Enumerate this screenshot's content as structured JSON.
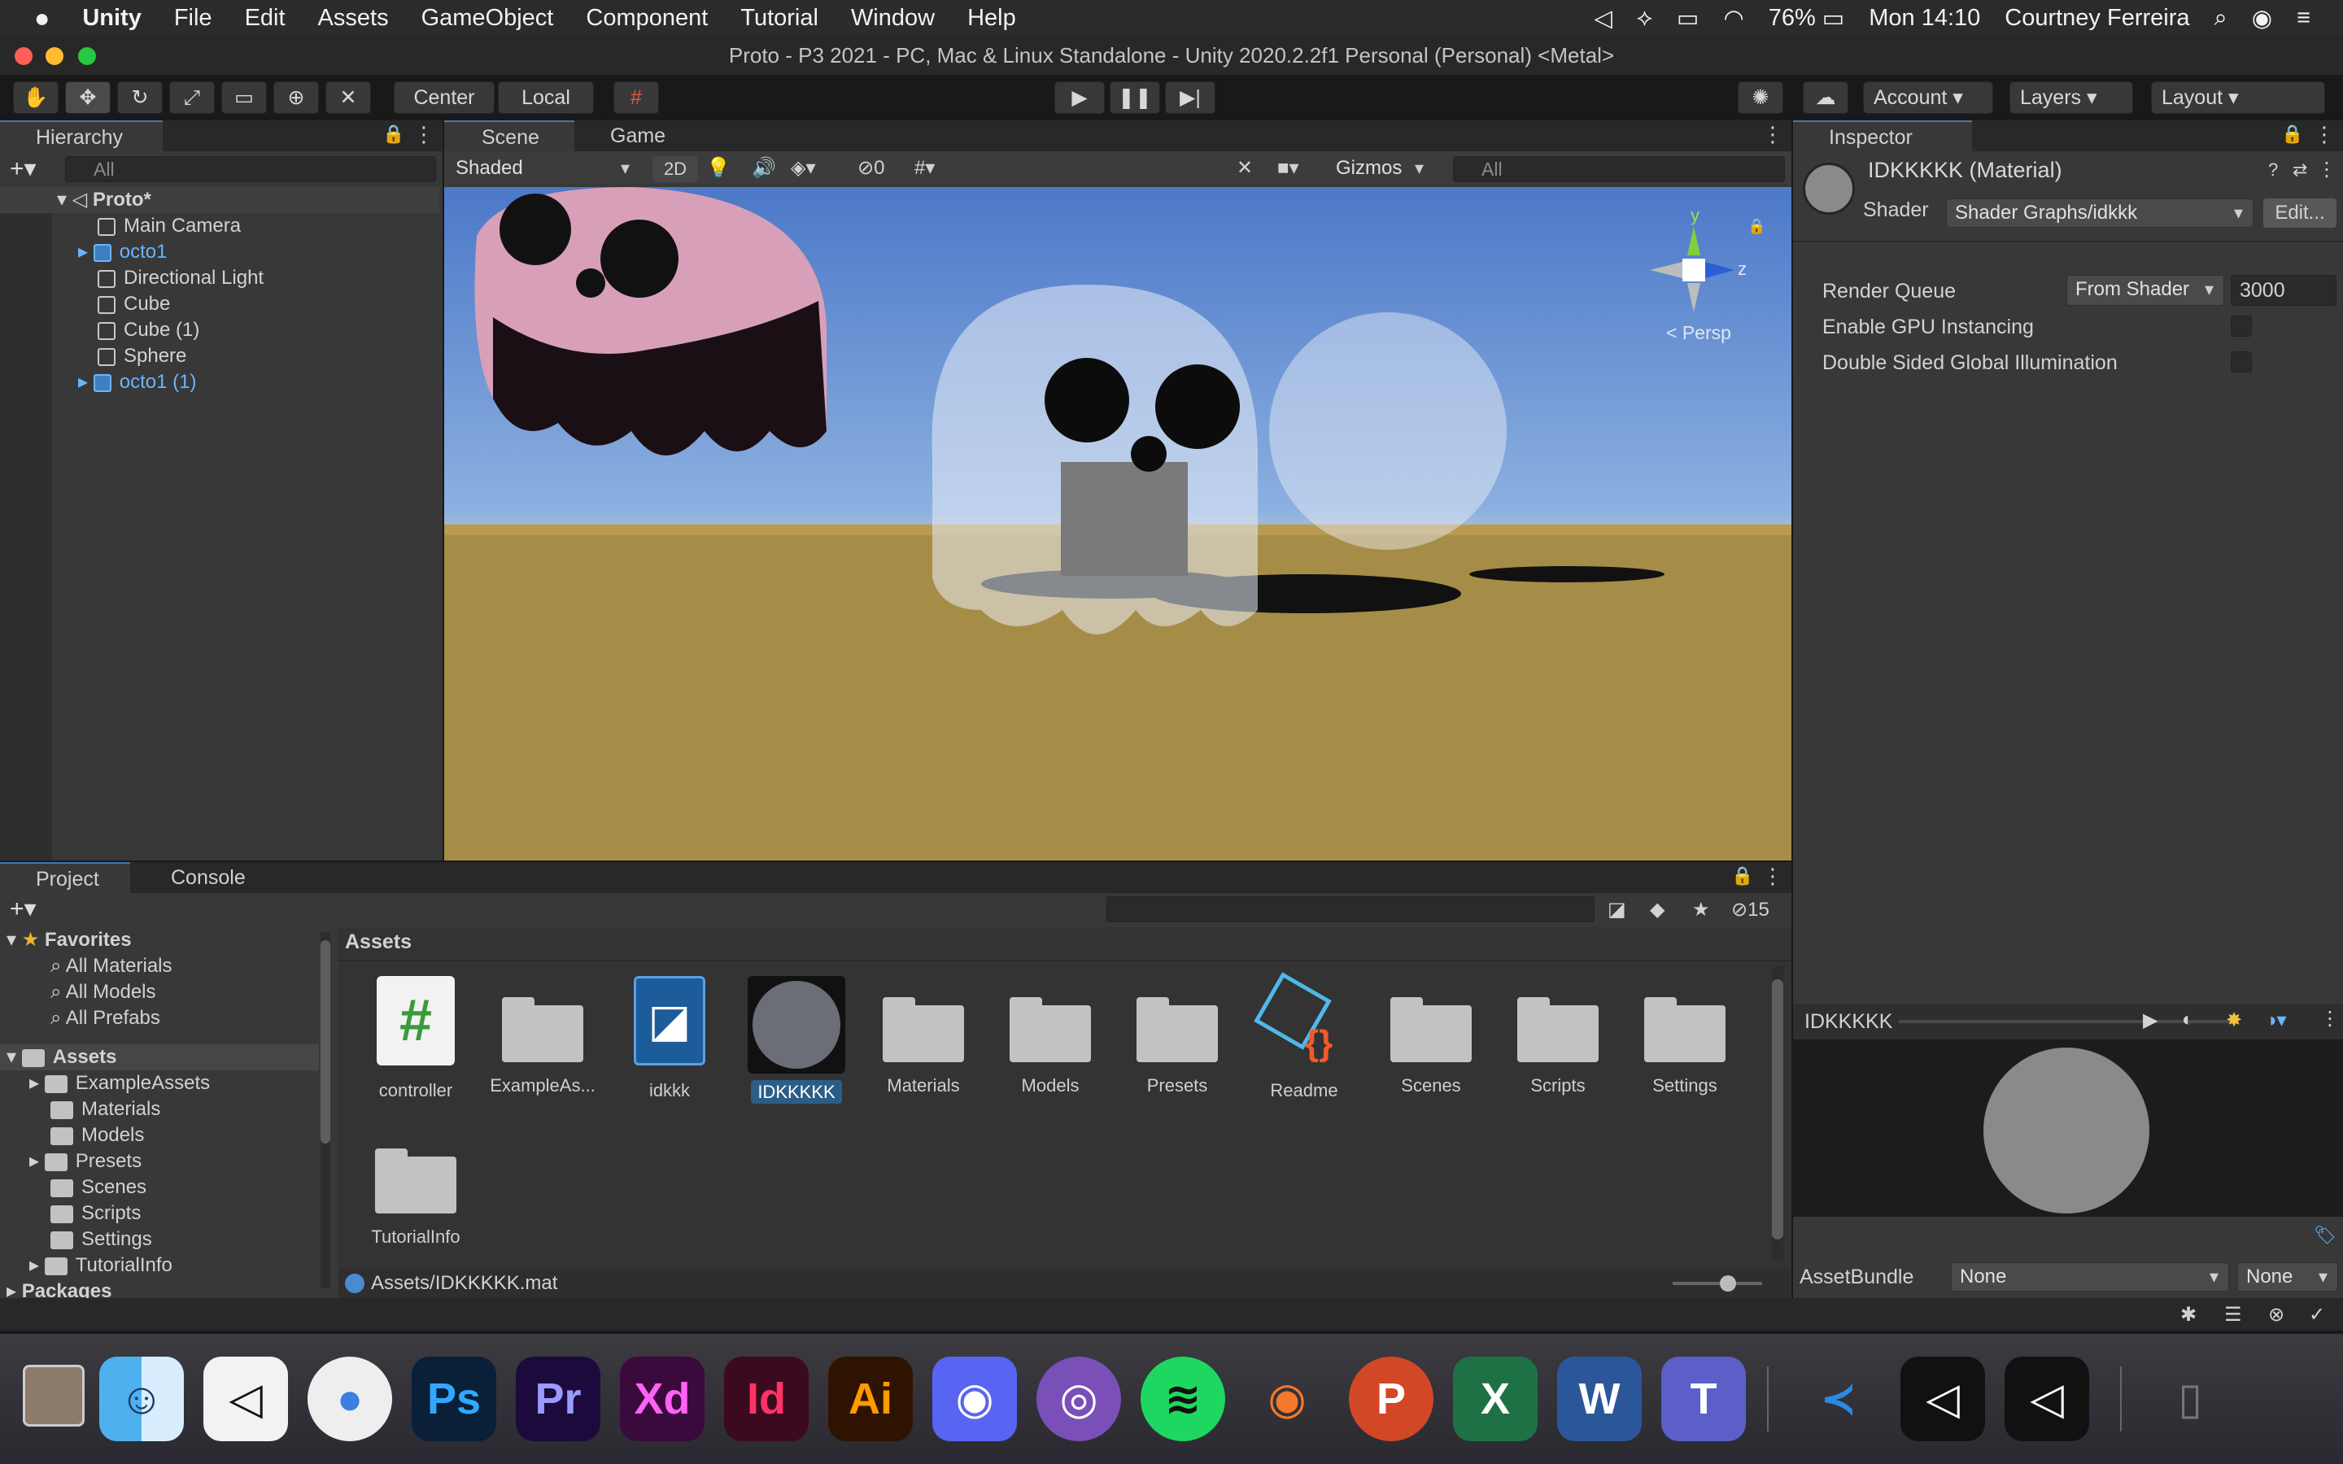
{
  "menubar": {
    "app": "Unity",
    "items": [
      "File",
      "Edit",
      "Assets",
      "GameObject",
      "Component",
      "Tutorial",
      "Window",
      "Help"
    ],
    "battery": "76%",
    "clock": "Mon 14:10",
    "user": "Courtney Ferreira"
  },
  "window": {
    "title": "Proto - P3 2021 - PC, Mac & Linux Standalone - Unity 2020.2.2f1 Personal (Personal) <Metal>"
  },
  "toolbar": {
    "center": "Center",
    "local": "Local",
    "account": "Account",
    "layers": "Layers",
    "layout": "Layout"
  },
  "hierarchy": {
    "tab": "Hierarchy",
    "search_placeholder": "All",
    "scene": "Proto*",
    "items": [
      "Main Camera",
      "octo1",
      "Directional Light",
      "Cube",
      "Cube (1)",
      "Sphere",
      "octo1 (1)"
    ]
  },
  "scene": {
    "tab_scene": "Scene",
    "tab_game": "Game",
    "shading": "Shaded",
    "mode_2d": "2D",
    "hidden_count": "0",
    "gizmos": "Gizmos",
    "search_placeholder": "All",
    "persp": "Persp",
    "axis_y": "y",
    "axis_z": "z"
  },
  "inspector": {
    "tab": "Inspector",
    "material": "IDKKKKK (Material)",
    "shader_label": "Shader",
    "shader_value": "Shader Graphs/idkkk",
    "edit": "Edit...",
    "render_queue_label": "Render Queue",
    "render_queue_mode": "From Shader",
    "render_queue_value": "3000",
    "gpu_instancing": "Enable GPU Instancing",
    "double_sided": "Double Sided Global Illumination",
    "preview_name": "IDKKKKK",
    "assetbundle_label": "AssetBundle",
    "assetbundle_value": "None",
    "assetbundle_variant": "None"
  },
  "project": {
    "tab_project": "Project",
    "tab_console": "Console",
    "hidden_count": "15",
    "favorites": "Favorites",
    "fav_items": [
      "All Materials",
      "All Models",
      "All Prefabs"
    ],
    "assets_root": "Assets",
    "asset_folders": [
      "ExampleAssets",
      "Materials",
      "Models",
      "Presets",
      "Scenes",
      "Scripts",
      "Settings",
      "TutorialInfo"
    ],
    "packages": "Packages",
    "breadcrumb": "Assets",
    "path": "Assets/IDKKKKK.mat",
    "grid": [
      "controller",
      "ExampleAs...",
      "idkkk",
      "IDKKKKK",
      "Materials",
      "Models",
      "Presets",
      "Readme",
      "Scenes",
      "Scripts",
      "Settings",
      "TutorialInfo"
    ]
  },
  "dock": {
    "apps": [
      "Finder",
      "Unity Hub",
      "Chrome",
      "Ps",
      "Pr",
      "Xd",
      "Id",
      "Ai",
      "Discord",
      "GitHub",
      "Spotify",
      "Blender",
      "P",
      "X",
      "W",
      "T",
      "VS Code",
      "Unity",
      "Unity",
      "Trash"
    ]
  }
}
